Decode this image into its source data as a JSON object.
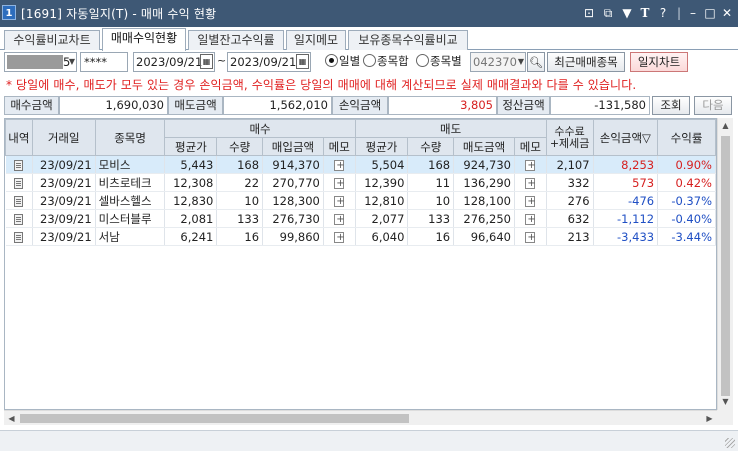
{
  "window": {
    "title": "[1691] 자동일지(T) - 매매 수익 현황",
    "icon_label": "1",
    "title_buttons": [
      "layout-icon",
      "copy-icon",
      "pin-icon",
      "font-icon",
      "help-icon",
      "minimize-icon",
      "maximize-icon",
      "close-icon"
    ]
  },
  "tabs": [
    {
      "label": "수익률비교차트",
      "active": false
    },
    {
      "label": "매매수익현황",
      "active": true
    },
    {
      "label": "일별잔고수익률",
      "active": false
    },
    {
      "label": "일지메모",
      "active": false
    },
    {
      "label": "보유종목수익률비교",
      "active": false
    }
  ],
  "controls": {
    "account_suffix": "5",
    "password": "****",
    "date_from": "2023/09/21",
    "date_sep": "~",
    "date_to": "2023/09/21",
    "radio_daily": "일별",
    "radio_stock_sum": "종목합",
    "radio_by_stock": "종목별",
    "stock_code": "042370",
    "recent_button": "최근매매종목",
    "journal_chart_button": "일지차트",
    "selected_radio": "daily"
  },
  "notice": "* 당일에 매수, 매도가 모두 있는 경우 손익금액, 수익률은 당일의 매매에 대해 계산되므로 실제 매매결과와 다를 수 있습니다.",
  "summary": {
    "buy_amount_label": "매수금액",
    "buy_amount": "1,690,030",
    "sell_amount_label": "매도금액",
    "sell_amount": "1,562,010",
    "pl_label": "손익금액",
    "pl_value": "3,805",
    "settle_label": "정산금액",
    "settle_value": "-131,580",
    "query_button": "조회",
    "next_button": "다음"
  },
  "table": {
    "headers": {
      "detail": "내역",
      "date": "거래일",
      "name": "종목명",
      "buy_group": "매수",
      "sell_group": "매도",
      "fee": "수수료\n+제세금",
      "pl": "손익금액▽",
      "rate": "수익률",
      "buy_avg": "평균가",
      "buy_qty": "수량",
      "buy_amt": "매입금액",
      "buy_memo": "메모",
      "sell_avg": "평균가",
      "sell_qty": "수량",
      "sell_amt": "매도금액",
      "sell_memo": "메모"
    },
    "rows": [
      {
        "date": "23/09/21",
        "name": "모비스",
        "buy_avg": "5,443",
        "buy_qty": "168",
        "buy_amt": "914,370",
        "sell_avg": "5,504",
        "sell_qty": "168",
        "sell_amt": "924,730",
        "fee": "2,107",
        "pl": "8,253",
        "rate": "0.90%",
        "sign": "pos"
      },
      {
        "date": "23/09/21",
        "name": "비츠로테크",
        "buy_avg": "12,308",
        "buy_qty": "22",
        "buy_amt": "270,770",
        "sell_avg": "12,390",
        "sell_qty": "11",
        "sell_amt": "136,290",
        "fee": "332",
        "pl": "573",
        "rate": "0.42%",
        "sign": "pos"
      },
      {
        "date": "23/09/21",
        "name": "셀바스헬스",
        "buy_avg": "12,830",
        "buy_qty": "10",
        "buy_amt": "128,300",
        "sell_avg": "12,810",
        "sell_qty": "10",
        "sell_amt": "128,100",
        "fee": "276",
        "pl": "-476",
        "rate": "-0.37%",
        "sign": "neg"
      },
      {
        "date": "23/09/21",
        "name": "미스터블루",
        "buy_avg": "2,081",
        "buy_qty": "133",
        "buy_amt": "276,730",
        "sell_avg": "2,077",
        "sell_qty": "133",
        "sell_amt": "276,250",
        "fee": "632",
        "pl": "-1,112",
        "rate": "-0.40%",
        "sign": "neg"
      },
      {
        "date": "23/09/21",
        "name": "서남",
        "buy_avg": "6,241",
        "buy_qty": "16",
        "buy_amt": "99,860",
        "sell_avg": "6,040",
        "sell_qty": "16",
        "sell_amt": "96,640",
        "fee": "213",
        "pl": "-3,433",
        "rate": "-3.44%",
        "sign": "neg"
      }
    ]
  },
  "colors": {
    "positive": "#d62020",
    "negative": "#1f4fc4",
    "titlebar": "#3e5875",
    "selected_row": "#d8ebfa"
  }
}
